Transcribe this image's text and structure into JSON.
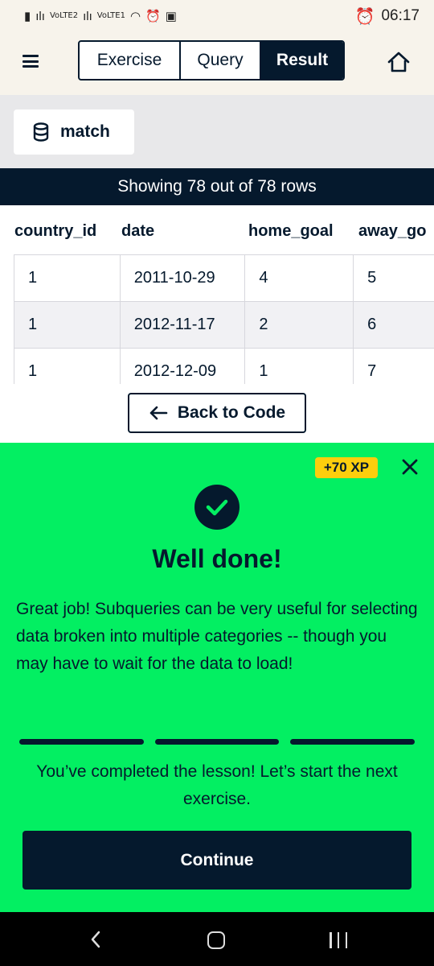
{
  "status_bar": {
    "time": "06:17",
    "network_1": "VoLTE2",
    "network_2": "VoLTE1"
  },
  "nav": {
    "tabs": [
      {
        "label": "Exercise",
        "active": false
      },
      {
        "label": "Query",
        "active": false
      },
      {
        "label": "Result",
        "active": true
      }
    ]
  },
  "result": {
    "table_name": "match",
    "rows_summary": "Showing 78 out of 78 rows",
    "columns": [
      "country_id",
      "date",
      "home_goal",
      "away_go"
    ],
    "rows": [
      [
        "1",
        "2011-10-29",
        "4",
        "5"
      ],
      [
        "1",
        "2012-11-17",
        "2",
        "6"
      ],
      [
        "1",
        "2012-12-09",
        "1",
        "7"
      ]
    ],
    "back_button": "Back to Code"
  },
  "feedback": {
    "xp": "+70 XP",
    "title": "Well done!",
    "message": "Great job! Subqueries can be very useful for selecting data broken into multiple categories -- though you may have to wait for the data to load!",
    "progress_segments": 3,
    "completion": "You’ve completed the lesson! Let’s start the next exercise.",
    "continue_button": "Continue"
  },
  "colors": {
    "navy": "#05192d",
    "green": "#03ef62",
    "xp_yellow": "#fcce0d",
    "cream": "#f7f3eb"
  }
}
